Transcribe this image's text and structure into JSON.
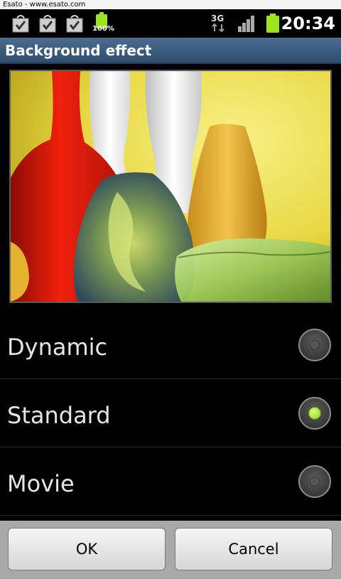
{
  "watermark": "Esato - www.esato.com",
  "status_bar": {
    "icons": [
      "download-done-icon",
      "download-done-icon",
      "download-done-icon",
      "battery-charging-icon",
      "3g-data-icon",
      "signal-strength-icon",
      "battery-icon"
    ],
    "battery_percent": "100%",
    "network": "3G",
    "time": "20:34"
  },
  "dialog": {
    "title": "Background effect",
    "preview_image": "glass-vases-image",
    "options": [
      {
        "label": "Dynamic",
        "selected": false
      },
      {
        "label": "Standard",
        "selected": true
      },
      {
        "label": "Movie",
        "selected": false
      }
    ],
    "buttons": {
      "ok": "OK",
      "cancel": "Cancel"
    }
  },
  "colors": {
    "title_bar": "#3a5a7c",
    "radio_selected": "#9be21f",
    "background": "#000000"
  }
}
